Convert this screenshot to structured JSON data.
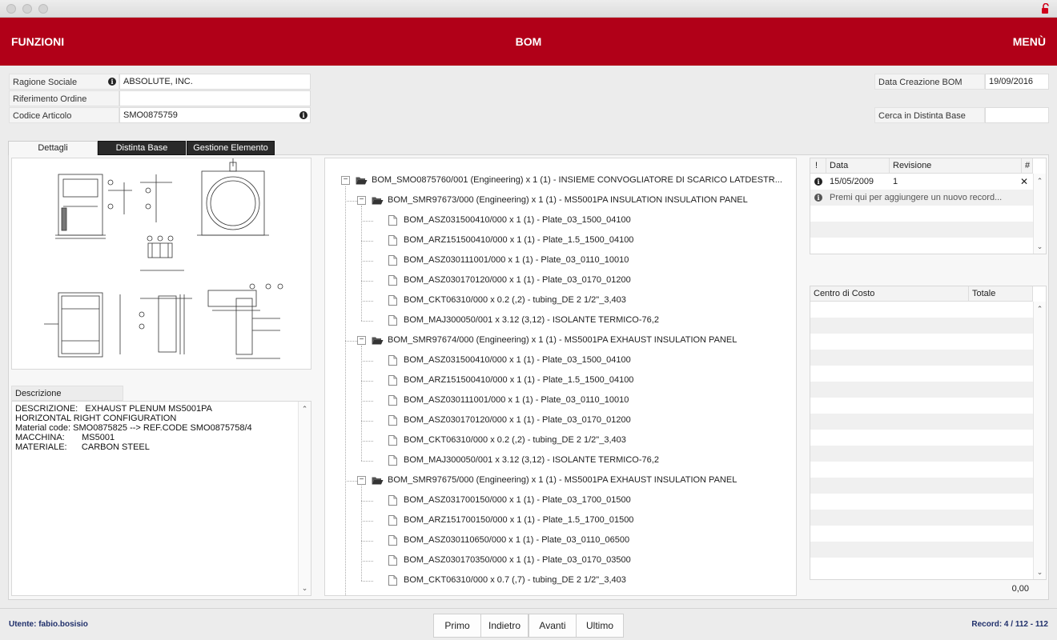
{
  "header": {
    "left_label": "FUNZIONI",
    "title": "BOM",
    "right_label": "MENÙ"
  },
  "form": {
    "ragione_sociale": {
      "label": "Ragione Sociale",
      "value": "ABSOLUTE, INC."
    },
    "riferimento_ordine": {
      "label": "Riferimento Ordine",
      "value": ""
    },
    "codice_articolo": {
      "label": "Codice Articolo",
      "value": "SMO0875759"
    },
    "data_creazione": {
      "label": "Data Creazione BOM",
      "value": "19/09/2016"
    },
    "cerca": {
      "label": "Cerca in Distinta Base",
      "value": ""
    }
  },
  "tabs": [
    {
      "label": "Dettagli",
      "active": true
    },
    {
      "label": "Distinta Base",
      "active": false
    },
    {
      "label": "Gestione Elemento",
      "active": false
    }
  ],
  "descrizione": {
    "label": "Descrizione",
    "lines": [
      "DESCRIZIONE:   EXHAUST PLENUM MS5001PA",
      "HORIZONTAL RIGHT CONFIGURATION",
      "Material code: SMO0875825 --> REF.CODE SMO0875758/4",
      "MACCHINA:       MS5001",
      "MATERIALE:      CARBON STEEL"
    ]
  },
  "tree": {
    "root": "BOM_SMO0875760/001 (Engineering) x 1 (1) - INSIEME CONVOGLIATORE DI SCARICO LATDESTR...",
    "groups": [
      {
        "label": "BOM_SMR97673/000 (Engineering) x 1 (1) - MS5001PA INSULATION INSULATION PANEL",
        "items": [
          "BOM_ASZ031500410/000 x 1 (1) - Plate_03_1500_04100",
          "BOM_ARZ151500410/000 x 1 (1) - Plate_1.5_1500_04100",
          "BOM_ASZ030111001/000 x 1 (1) - Plate_03_0110_10010",
          "BOM_ASZ030170120/000 x 1 (1) - Plate_03_0170_01200",
          "BOM_CKT06310/000 x 0.2 (,2) - tubing_DE 2 1/2\"_3,403",
          "BOM_MAJ300050/001 x 3.12 (3,12) - ISOLANTE TERMICO-76,2"
        ]
      },
      {
        "label": "BOM_SMR97674/000 (Engineering) x 1 (1) - MS5001PA EXHAUST INSULATION PANEL",
        "items": [
          "BOM_ASZ031500410/000 x 1 (1) - Plate_03_1500_04100",
          "BOM_ARZ151500410/000 x 1 (1) - Plate_1.5_1500_04100",
          "BOM_ASZ030111001/000 x 1 (1) - Plate_03_0110_10010",
          "BOM_ASZ030170120/000 x 1 (1) - Plate_03_0170_01200",
          "BOM_CKT06310/000 x 0.2 (,2) - tubing_DE 2 1/2\"_3,403",
          "BOM_MAJ300050/001 x 3.12 (3,12) - ISOLANTE TERMICO-76,2"
        ]
      },
      {
        "label": "BOM_SMR97675/000 (Engineering) x 1 (1) - MS5001PA EXHAUST INSULATION PANEL",
        "items": [
          "BOM_ASZ031700150/000 x 1 (1) - Plate_03_1700_01500",
          "BOM_ARZ151700150/000 x 1 (1) - Plate_1.5_1700_01500",
          "BOM_ASZ030110650/000 x 1 (1) - Plate_03_0110_06500",
          "BOM_ASZ030170350/000 x 1 (1) - Plate_03_0170_03500",
          "BOM_CKT06310/000 x 0.7 (,7) - tubing_DE 2 1/2\"_3,403"
        ]
      }
    ]
  },
  "revisions": {
    "headers": [
      "!",
      "Data",
      "Revisione",
      "#"
    ],
    "rows": [
      {
        "data": "15/05/2009",
        "revisione": "1",
        "delete": "✕"
      }
    ],
    "add_placeholder": "Premi qui per aggiungere un nuovo record..."
  },
  "costi": {
    "headers": [
      "Centro di Costo",
      "Totale"
    ],
    "total": "0,00"
  },
  "footer": {
    "user": "Utente: fabio.bosisio",
    "record": "Record: 4 / 112 - 112",
    "nav": [
      "Primo",
      "Indietro",
      "Avanti",
      "Ultimo"
    ]
  }
}
